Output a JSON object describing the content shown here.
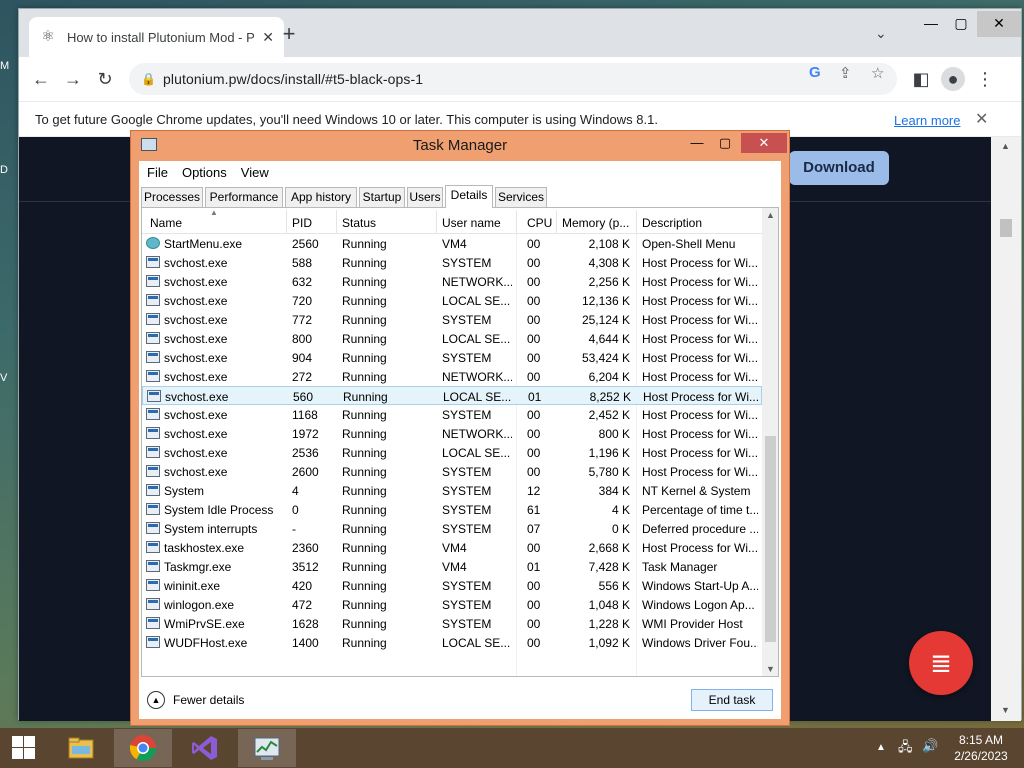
{
  "desktop": {
    "edge_letters": [
      "M",
      "D",
      "V"
    ]
  },
  "browser": {
    "tab_title": "How to install Plutonium Mod - P",
    "url": "plutonium.pw/docs/install/#t5-black-ops-1",
    "infobar_message": "To get future Google Chrome updates, you'll need Windows 10 or later. This computer is using Windows 8.1.",
    "infobar_link": "Learn more",
    "page_download_label": "Download"
  },
  "task_manager": {
    "title": "Task Manager",
    "menu": [
      "File",
      "Options",
      "View"
    ],
    "tabs": [
      "Processes",
      "Performance",
      "App history",
      "Startup",
      "Users",
      "Details",
      "Services"
    ],
    "active_tab": "Details",
    "columns": [
      "Name",
      "PID",
      "Status",
      "User name",
      "CPU",
      "Memory (p...",
      "Description"
    ],
    "rows": [
      {
        "name": "StartMenu.exe",
        "pid": "2560",
        "status": "Running",
        "user": "VM4",
        "cpu": "00",
        "mem": "2,108 K",
        "desc": "Open-Shell Menu",
        "icon": "shell-menu"
      },
      {
        "name": "svchost.exe",
        "pid": "588",
        "status": "Running",
        "user": "SYSTEM",
        "cpu": "00",
        "mem": "4,308 K",
        "desc": "Host Process for Wi...",
        "icon": "window"
      },
      {
        "name": "svchost.exe",
        "pid": "632",
        "status": "Running",
        "user": "NETWORK...",
        "cpu": "00",
        "mem": "2,256 K",
        "desc": "Host Process for Wi...",
        "icon": "window"
      },
      {
        "name": "svchost.exe",
        "pid": "720",
        "status": "Running",
        "user": "LOCAL SE...",
        "cpu": "00",
        "mem": "12,136 K",
        "desc": "Host Process for Wi...",
        "icon": "window"
      },
      {
        "name": "svchost.exe",
        "pid": "772",
        "status": "Running",
        "user": "SYSTEM",
        "cpu": "00",
        "mem": "25,124 K",
        "desc": "Host Process for Wi...",
        "icon": "window"
      },
      {
        "name": "svchost.exe",
        "pid": "800",
        "status": "Running",
        "user": "LOCAL SE...",
        "cpu": "00",
        "mem": "4,644 K",
        "desc": "Host Process for Wi...",
        "icon": "window"
      },
      {
        "name": "svchost.exe",
        "pid": "904",
        "status": "Running",
        "user": "SYSTEM",
        "cpu": "00",
        "mem": "53,424 K",
        "desc": "Host Process for Wi...",
        "icon": "window"
      },
      {
        "name": "svchost.exe",
        "pid": "272",
        "status": "Running",
        "user": "NETWORK...",
        "cpu": "00",
        "mem": "6,204 K",
        "desc": "Host Process for Wi...",
        "icon": "window"
      },
      {
        "name": "svchost.exe",
        "pid": "560",
        "status": "Running",
        "user": "LOCAL SE...",
        "cpu": "01",
        "mem": "8,252 K",
        "desc": "Host Process for Wi...",
        "icon": "window",
        "selected": true
      },
      {
        "name": "svchost.exe",
        "pid": "1168",
        "status": "Running",
        "user": "SYSTEM",
        "cpu": "00",
        "mem": "2,452 K",
        "desc": "Host Process for Wi...",
        "icon": "window"
      },
      {
        "name": "svchost.exe",
        "pid": "1972",
        "status": "Running",
        "user": "NETWORK...",
        "cpu": "00",
        "mem": "800 K",
        "desc": "Host Process for Wi...",
        "icon": "window"
      },
      {
        "name": "svchost.exe",
        "pid": "2536",
        "status": "Running",
        "user": "LOCAL SE...",
        "cpu": "00",
        "mem": "1,196 K",
        "desc": "Host Process for Wi...",
        "icon": "window"
      },
      {
        "name": "svchost.exe",
        "pid": "2600",
        "status": "Running",
        "user": "SYSTEM",
        "cpu": "00",
        "mem": "5,780 K",
        "desc": "Host Process for Wi...",
        "icon": "window"
      },
      {
        "name": "System",
        "pid": "4",
        "status": "Running",
        "user": "SYSTEM",
        "cpu": "12",
        "mem": "384 K",
        "desc": "NT Kernel & System",
        "icon": "window"
      },
      {
        "name": "System Idle Process",
        "pid": "0",
        "status": "Running",
        "user": "SYSTEM",
        "cpu": "61",
        "mem": "4 K",
        "desc": "Percentage of time t...",
        "icon": "window"
      },
      {
        "name": "System interrupts",
        "pid": "-",
        "status": "Running",
        "user": "SYSTEM",
        "cpu": "07",
        "mem": "0 K",
        "desc": "Deferred procedure ...",
        "icon": "window"
      },
      {
        "name": "taskhostex.exe",
        "pid": "2360",
        "status": "Running",
        "user": "VM4",
        "cpu": "00",
        "mem": "2,668 K",
        "desc": "Host Process for Wi...",
        "icon": "window"
      },
      {
        "name": "Taskmgr.exe",
        "pid": "3512",
        "status": "Running",
        "user": "VM4",
        "cpu": "01",
        "mem": "7,428 K",
        "desc": "Task Manager",
        "icon": "window"
      },
      {
        "name": "wininit.exe",
        "pid": "420",
        "status": "Running",
        "user": "SYSTEM",
        "cpu": "00",
        "mem": "556 K",
        "desc": "Windows Start-Up A...",
        "icon": "window"
      },
      {
        "name": "winlogon.exe",
        "pid": "472",
        "status": "Running",
        "user": "SYSTEM",
        "cpu": "00",
        "mem": "1,048 K",
        "desc": "Windows Logon Ap...",
        "icon": "window"
      },
      {
        "name": "WmiPrvSE.exe",
        "pid": "1628",
        "status": "Running",
        "user": "SYSTEM",
        "cpu": "00",
        "mem": "1,228 K",
        "desc": "WMI Provider Host",
        "icon": "window"
      },
      {
        "name": "WUDFHost.exe",
        "pid": "1400",
        "status": "Running",
        "user": "LOCAL SE...",
        "cpu": "00",
        "mem": "1,092 K",
        "desc": "Windows Driver Fou...",
        "icon": "window"
      }
    ],
    "fewer_details_label": "Fewer details",
    "end_task_label": "End task"
  },
  "taskbar": {
    "apps": [
      "file-explorer",
      "chrome",
      "visual-studio",
      "task-manager"
    ],
    "time": "8:15 AM",
    "date": "2/26/2023"
  }
}
